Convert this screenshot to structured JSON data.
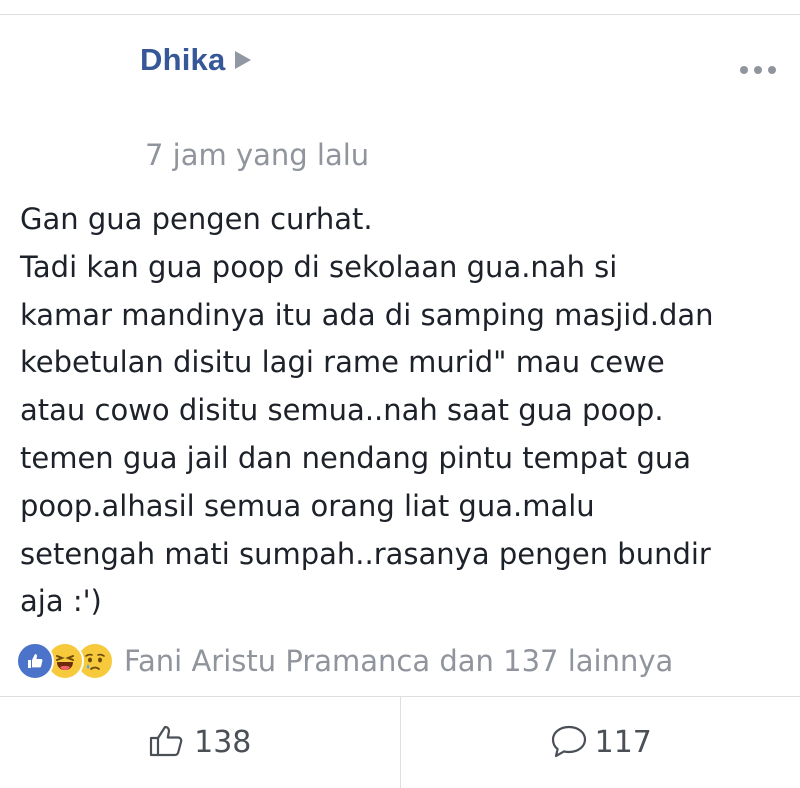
{
  "post": {
    "author": "Dhika",
    "timestamp": "7 jam yang lalu",
    "body_lines": [
      "Gan gua pengen curhat.",
      "Tadi kan gua poop di sekolaan gua.nah si",
      "kamar mandinya itu ada di samping masjid.dan",
      "kebetulan disitu lagi rame murid\" mau cewe",
      "atau cowo disitu semua..nah saat gua poop.",
      "temen gua jail dan nendang pintu tempat gua",
      "poop.alhasil semua orang liat gua.malu",
      "setengah mati sumpah..rasanya pengen bundir",
      "aja :')"
    ]
  },
  "reactions": {
    "icons": [
      "like-icon",
      "haha-icon",
      "sad-icon"
    ],
    "summary": "Fani Aristu Pramanca dan 137 lainnya"
  },
  "actions": {
    "like_count": "138",
    "comment_count": "117"
  },
  "colors": {
    "author": "#365899",
    "muted": "#90949c",
    "like_blue": "#4b73c9",
    "emoji_yellow": "#f7c93c"
  }
}
